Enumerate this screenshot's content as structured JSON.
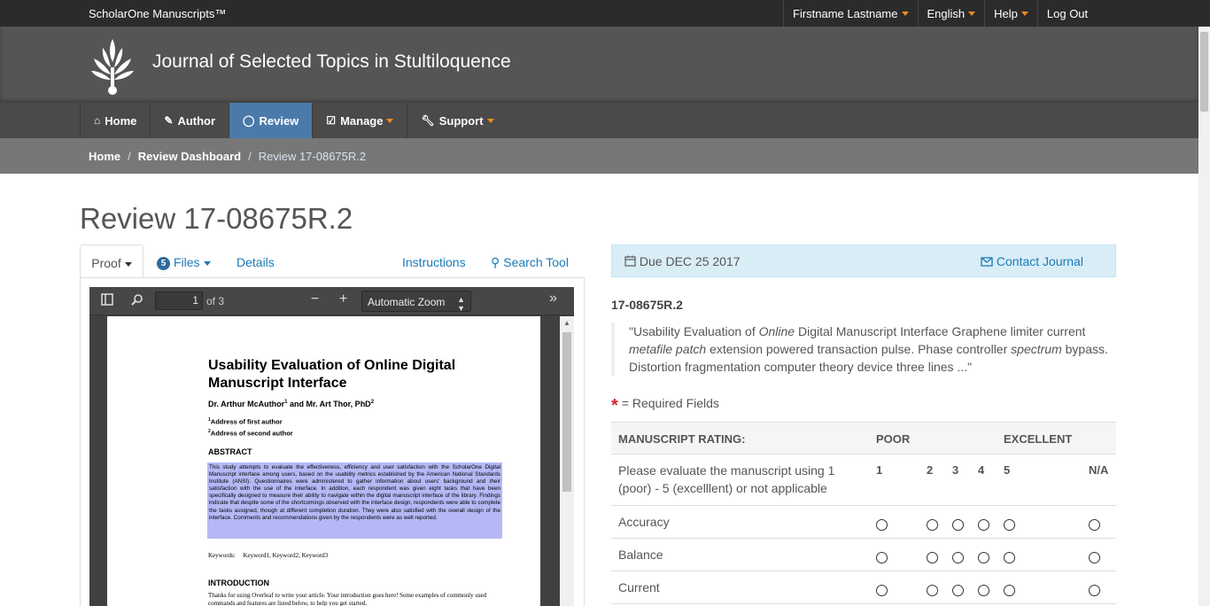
{
  "topbar": {
    "brand": "ScholarOne Manuscripts™",
    "user": "Firstname Lastname",
    "language": "English",
    "help": "Help",
    "logout": "Log Out"
  },
  "header": {
    "journal_title": "Journal of Selected Topics in Stultiloquence"
  },
  "nav": {
    "home": "Home",
    "author": "Author",
    "review": "Review",
    "manage": "Manage",
    "support": "Support",
    "active": "Review"
  },
  "breadcrumb": {
    "home": "Home",
    "dashboard": "Review Dashboard",
    "current": "Review 17-08675R.2"
  },
  "page_title": "Review 17-08675R.2",
  "tabs": {
    "proof": "Proof",
    "files_count": "5",
    "files": "Files",
    "details": "Details",
    "instructions": "Instructions",
    "search_tool": "Search Tool"
  },
  "viewer": {
    "page_number": "1",
    "of_pages": "of 3",
    "zoom": "Automatic Zoom"
  },
  "paper": {
    "title": "Usability Evaluation of Online Digital Manuscript Interface",
    "authors": "Dr. Arthur McAuthor",
    "authors_sup1": "1",
    "authors_and": " and Mr. Art Thor, PhD",
    "authors_sup2": "2",
    "addr1_sup": "1",
    "addr1": "Address of first author",
    "addr2_sup": "2",
    "addr2": "Address of second author",
    "abstract_heading": "ABSTRACT",
    "abstract": "This study attempts to evaluate the effectiveness, efficiency and user satisfaction with the ScholarOne Digital Manuscript interface among users, based on the usability metrics established by the American National Standards Institute (ANSI). Questionnaires were administered to gather information about users' background and their satisfaction with the use of the interface. In addition, each respondent was given eight tasks that have been specifically designed to measure their ability to navigate within the digital manuscript interface of the library. Findings indicate that despite some of the shortcomings observed with the interface design, respondents were able to complete the tasks assigned, though at different completion duration. They were also satisfied with the overall design of the interface. Comments and recommendations given by the respondents were as well reported.",
    "keywords_label": "Keywords:",
    "keywords": "Keyword1, Keyword2, Keyword3",
    "intro_heading": "INTRODUCTION",
    "intro_text": "Thanks for using Overleaf to write your article. Your introduction goes here! Some examples of commonly used commands and features are listed below, to help you get started."
  },
  "due": {
    "text": "Due DEC 25 2017",
    "contact": "Contact Journal"
  },
  "manuscript": {
    "id": "17-08675R.2",
    "abstract_q1": "\"Usability Evaluation of ",
    "abstract_q1_em": "Online",
    "abstract_q2": " Digital Manuscript Interface Graphene limiter current ",
    "abstract_q2_em": "metafile patch",
    "abstract_q3": " extension powered transaction pulse. Phase controller ",
    "abstract_q3_em": "spectrum",
    "abstract_q4": " bypass. Distortion fragmentation computer theory device three lines ...\""
  },
  "required_text": "= Required Fields",
  "rating": {
    "header": "MANUSCRIPT RATING:",
    "poor": "POOR",
    "excellent": "EXCELLENT",
    "instruction": "Please evaluate the manuscript using 1 (poor) - 5 (excelllent) or not applicable",
    "scale": [
      "1",
      "2",
      "3",
      "4",
      "5",
      "N/A"
    ],
    "criteria": [
      "Accuracy",
      "Balance",
      "Current"
    ]
  }
}
